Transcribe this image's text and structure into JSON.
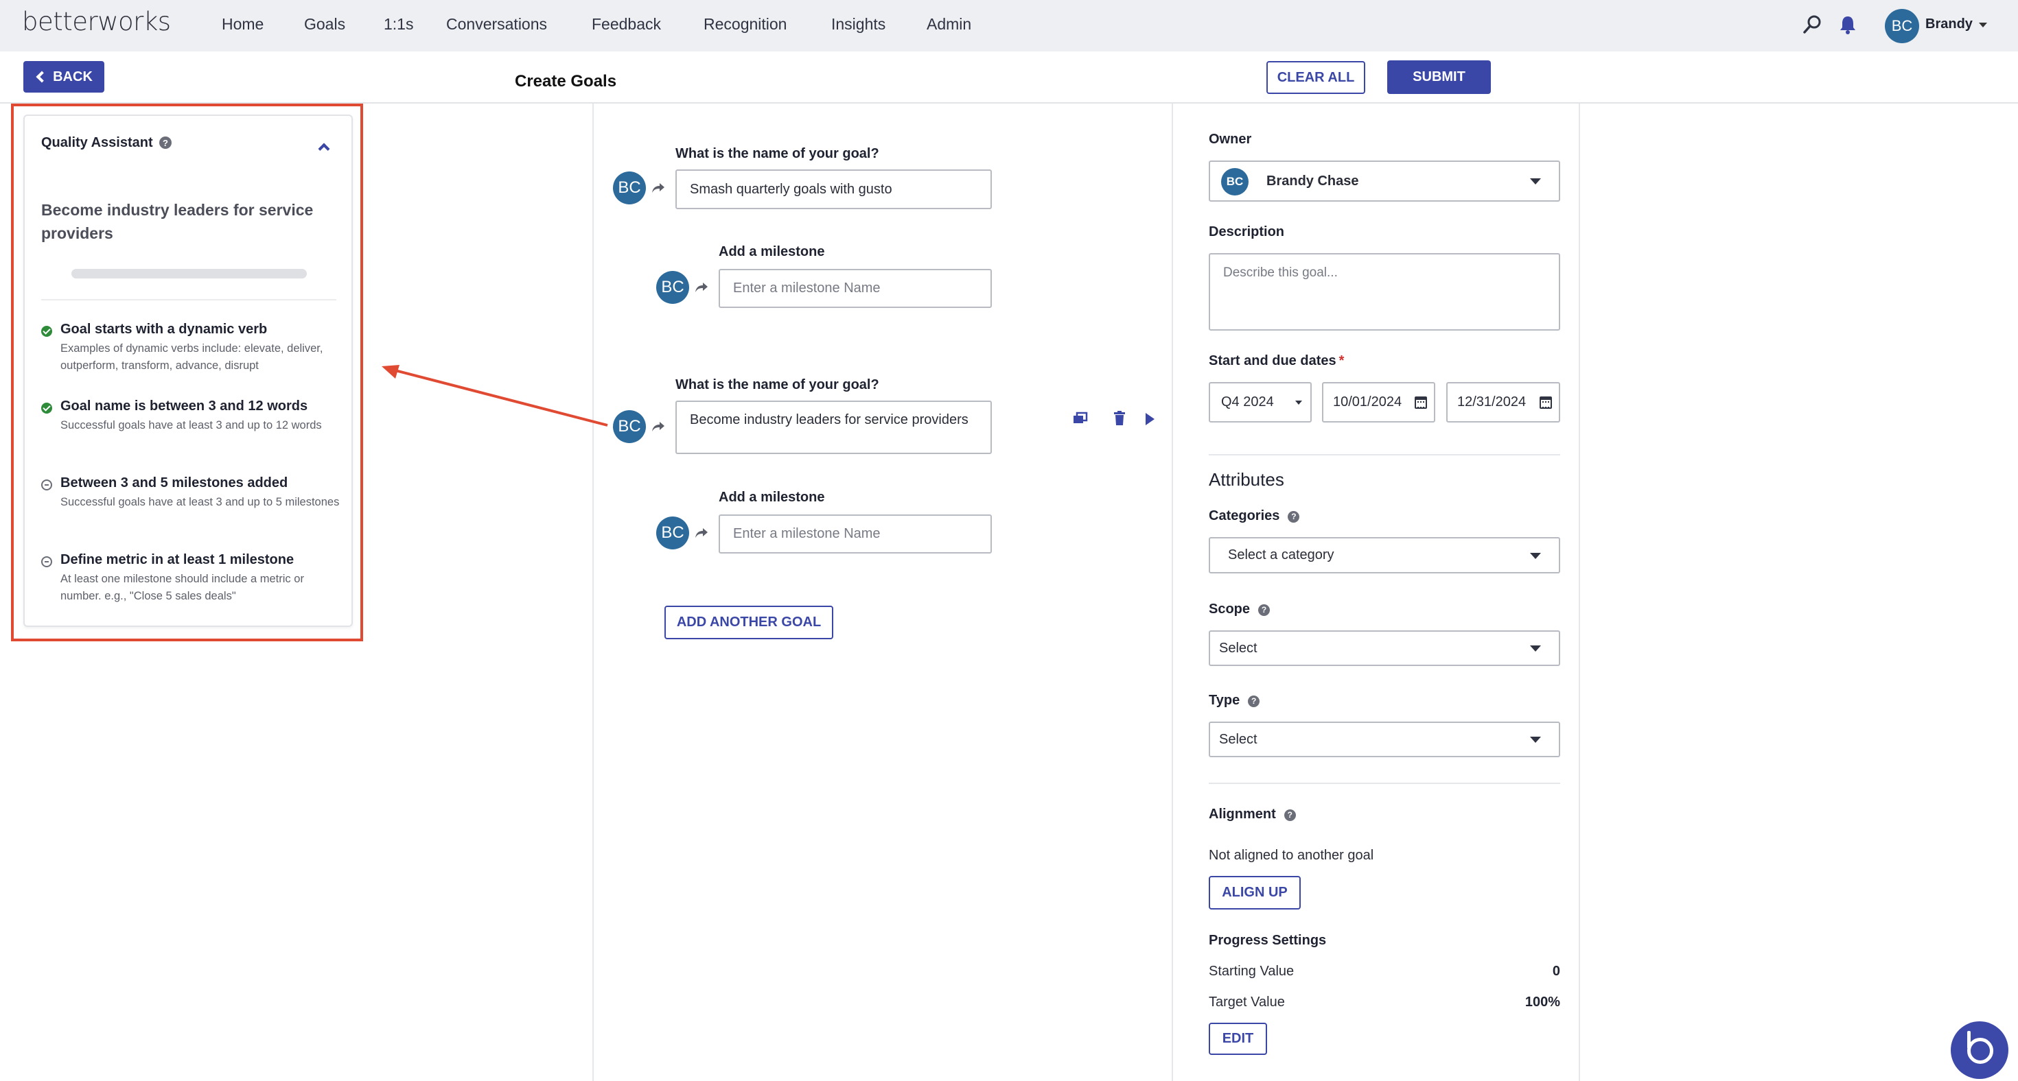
{
  "app": {
    "logo": "betterworks"
  },
  "nav": {
    "items": [
      "Home",
      "Goals",
      "1:1s",
      "Conversations",
      "Feedback",
      "Recognition",
      "Insights",
      "Admin"
    ],
    "user_initials": "BC",
    "user_name": "Brandy"
  },
  "header": {
    "back_label": "BACK",
    "title": "Create Goals",
    "clear_label": "CLEAR ALL",
    "submit_label": "SUBMIT"
  },
  "quality_assistant": {
    "title": "Quality Assistant",
    "goal_text": "Become industry leaders for service providers",
    "progress": 0,
    "checks": [
      {
        "title": "Goal starts with a dynamic verb",
        "desc": "Examples of dynamic verbs include: elevate, deliver, outperform, transform, advance, disrupt",
        "status": "passed"
      },
      {
        "title": "Goal name is between 3 and 12 words",
        "desc": "Successful goals have at least 3 and up to 12 words",
        "status": "passed"
      },
      {
        "title": "Between 3 and 5 milestones added",
        "desc": "Successful goals have at least 3 and up to 5 milestones",
        "status": "pending"
      },
      {
        "title": "Define metric in at least 1 milestone",
        "desc": "At least one milestone should include a metric or number. e.g., \"Close 5 sales deals\"",
        "status": "pending"
      }
    ]
  },
  "goals": [
    {
      "owner_initials": "BC",
      "name_label": "What is the name of your goal?",
      "name_value": "Smash quarterly goals with gusto",
      "milestone_label": "Add a milestone",
      "milestone_initials": "BC",
      "milestone_placeholder": "Enter a milestone Name"
    },
    {
      "owner_initials": "BC",
      "name_label": "What is the name of your goal?",
      "name_value": "Become industry leaders for service providers",
      "milestone_label": "Add a milestone",
      "milestone_initials": "BC",
      "milestone_placeholder": "Enter a milestone Name"
    }
  ],
  "add_goal_label": "ADD ANOTHER GOAL",
  "details": {
    "owner_label": "Owner",
    "owner_initials": "BC",
    "owner_name": "Brandy Chase",
    "description_label": "Description",
    "description_placeholder": "Describe this goal...",
    "dates_label": "Start and due dates",
    "dates_required": "*",
    "period": "Q4 2024",
    "start_date": "10/01/2024",
    "due_date": "12/31/2024",
    "attributes_title": "Attributes",
    "categories_label": "Categories",
    "categories_value": "Select a category",
    "scope_label": "Scope",
    "scope_value": "Select",
    "type_label": "Type",
    "type_value": "Select",
    "alignment_label": "Alignment",
    "alignment_text": "Not aligned to another goal",
    "align_up_label": "ALIGN UP",
    "progress_label": "Progress Settings",
    "starting_label": "Starting Value",
    "starting_value": "0",
    "target_label": "Target Value",
    "target_value": "100%",
    "edit_label": "EDIT"
  },
  "colors": {
    "accent": "#3b47a6",
    "avatar": "#2b6a9a",
    "annotation": "#e14a32",
    "success": "#2e8b3a"
  }
}
